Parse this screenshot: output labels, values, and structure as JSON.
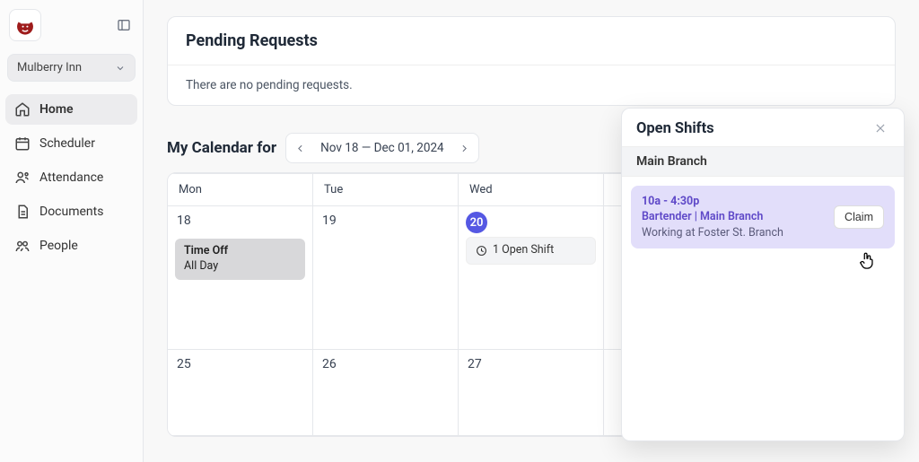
{
  "org": {
    "name": "Mulberry Inn"
  },
  "nav": {
    "home": "Home",
    "scheduler": "Scheduler",
    "attendance": "Attendance",
    "documents": "Documents",
    "people": "People"
  },
  "pending": {
    "title": "Pending Requests",
    "empty_text": "There are no pending requests."
  },
  "calendar": {
    "title": "My Calendar for",
    "range": "Nov 18 — Dec 01, 2024",
    "week1_days": [
      "Mon",
      "Tue",
      "Wed"
    ],
    "week1_nums": [
      "18",
      "19",
      "20"
    ],
    "week2_nums": [
      "25",
      "26",
      "27"
    ],
    "today_index": 2,
    "timeoff": {
      "line1": "Time Off",
      "line2": "All Day"
    },
    "open_shift_chip": "1 Open Shift"
  },
  "panel": {
    "title": "Open Shifts",
    "branch": "Main Branch",
    "shift": {
      "time": "10a - 4:30p",
      "role_loc": "Bartender | Main Branch",
      "note": "Working at Foster St. Branch",
      "claim_label": "Claim"
    }
  }
}
